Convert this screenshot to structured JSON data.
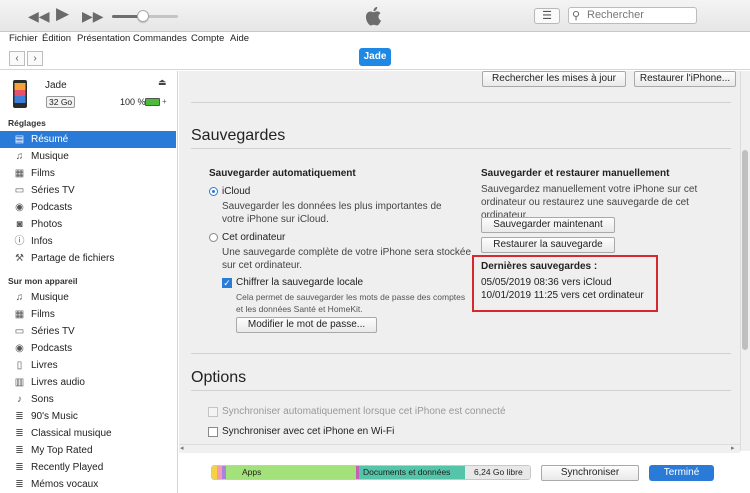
{
  "toolbar": {
    "rewind_icon": "rewind-icon",
    "play_icon": "play-icon",
    "forward_icon": "fast-forward-icon",
    "volume_level": 0.4,
    "search_placeholder": "Rechercher"
  },
  "menubar": [
    "Fichier",
    "Édition",
    "Présentation",
    "Commandes",
    "Compte",
    "Aide"
  ],
  "device_tab": "Jade",
  "device": {
    "name": "Jade",
    "capacity": "32 Go",
    "battery": "100 %",
    "battery_level": 1.0
  },
  "sidebar": {
    "reglages_header": "Réglages",
    "reglages": [
      {
        "label": "Résumé",
        "icon": "summary-icon",
        "selected": true
      },
      {
        "label": "Musique",
        "icon": "music-note-icon"
      },
      {
        "label": "Films",
        "icon": "film-icon"
      },
      {
        "label": "Séries TV",
        "icon": "tv-icon"
      },
      {
        "label": "Podcasts",
        "icon": "podcast-icon"
      },
      {
        "label": "Photos",
        "icon": "camera-icon"
      },
      {
        "label": "Infos",
        "icon": "info-icon"
      },
      {
        "label": "Partage de fichiers",
        "icon": "file-sharing-icon"
      }
    ],
    "appareil_header": "Sur mon appareil",
    "appareil": [
      {
        "label": "Musique",
        "icon": "music-note-icon"
      },
      {
        "label": "Films",
        "icon": "film-icon"
      },
      {
        "label": "Séries TV",
        "icon": "tv-icon"
      },
      {
        "label": "Podcasts",
        "icon": "podcast-icon"
      },
      {
        "label": "Livres",
        "icon": "book-icon"
      },
      {
        "label": "Livres audio",
        "icon": "audiobook-icon"
      },
      {
        "label": "Sons",
        "icon": "bell-icon"
      },
      {
        "label": "90's Music",
        "icon": "playlist-icon"
      },
      {
        "label": "Classical musique",
        "icon": "playlist-icon"
      },
      {
        "label": "My Top Rated",
        "icon": "playlist-icon"
      },
      {
        "label": "Recently Played",
        "icon": "playlist-icon"
      },
      {
        "label": "Mémos vocaux",
        "icon": "playlist-icon"
      }
    ]
  },
  "main": {
    "check_updates_button": "Rechercher les mises à jour",
    "restore_iphone_button": "Restaurer l'iPhone...",
    "sauvegardes_title": "Sauvegardes",
    "auto_title": "Sauvegarder automatiquement",
    "icloud_label": "iCloud",
    "icloud_desc": "Sauvegarder les données les plus importantes de votre iPhone sur iCloud.",
    "computer_label": "Cet ordinateur",
    "computer_desc": "Une sauvegarde complète de votre iPhone sera stockée sur cet ordinateur.",
    "encrypt_label": "Chiffrer la sauvegarde locale",
    "encrypt_desc": "Cela permet de sauvegarder les mots de passe des comptes et les données Santé et HomeKit.",
    "change_password_button": "Modifier le mot de passe...",
    "manual_title": "Sauvegarder et restaurer manuellement",
    "manual_desc": "Sauvegardez manuellement votre iPhone sur cet ordinateur ou restaurez une sauvegarde de cet ordinateur.",
    "backup_now_button": "Sauvegarder maintenant",
    "restore_backup_button": "Restaurer la sauvegarde",
    "last_backups_title": "Dernières sauvegardes :",
    "last_backup_1": "05/05/2019 08:36 vers iCloud",
    "last_backup_2": "10/01/2019 11:25 vers cet ordinateur",
    "options_title": "Options",
    "option_sync_auto": "Synchroniser automatiquement lorsque cet iPhone est connecté",
    "option_wifi": "Synchroniser avec cet iPhone en Wi-Fi"
  },
  "storage": {
    "apps_label": "Apps",
    "documents_label": "Documents et données",
    "free_label": "6,24 Go libre",
    "colors": {
      "apps": "#a3e27a",
      "documents": "#55c5a9",
      "free": "#e8e8e8",
      "photos": "#f4d341",
      "other": "#f29ab6"
    }
  },
  "bottom": {
    "sync_button": "Synchroniser",
    "done_button": "Terminé"
  },
  "colors": {
    "accent": "#2a7bd8",
    "highlight": "#d9272e"
  }
}
